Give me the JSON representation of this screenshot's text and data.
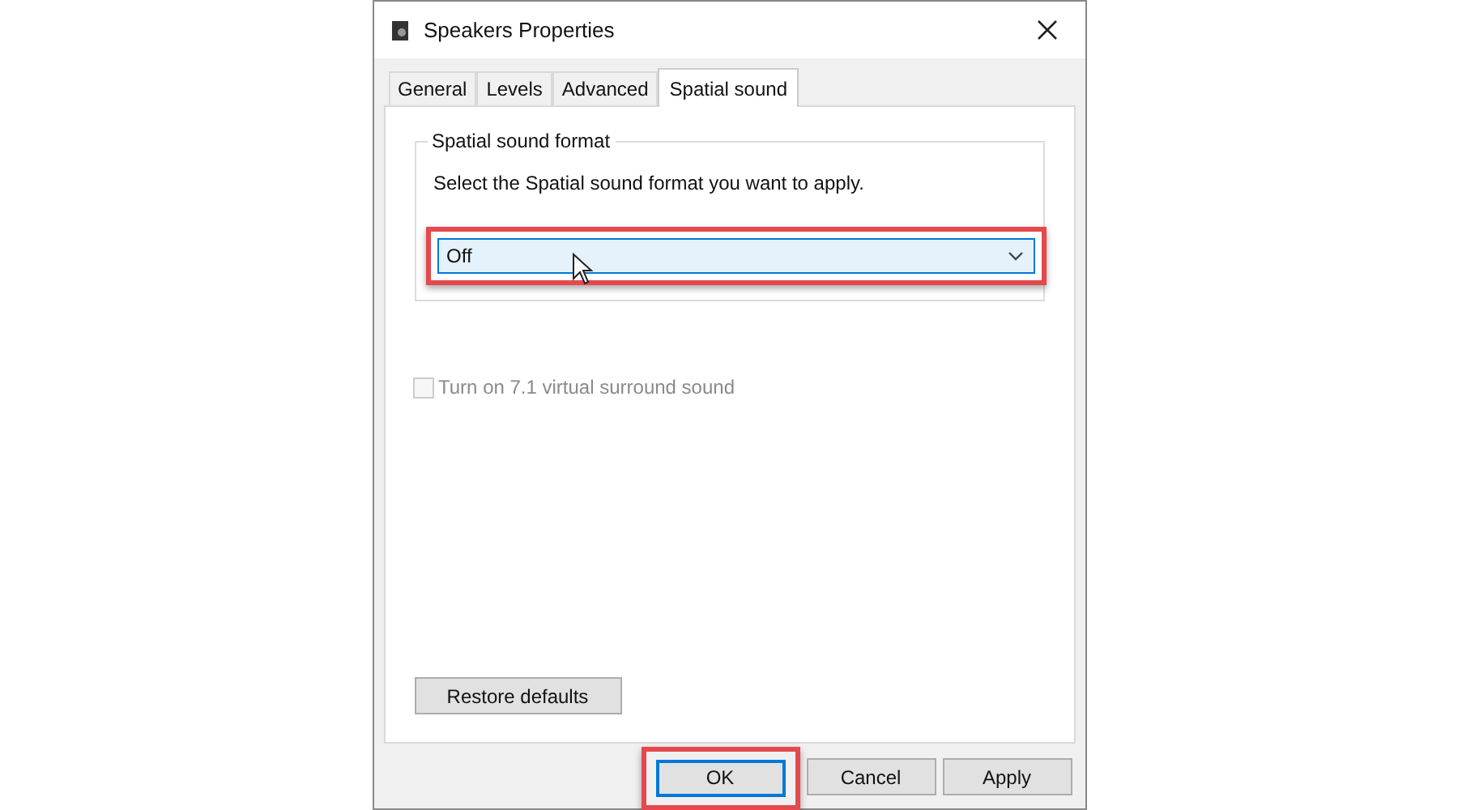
{
  "window": {
    "title": "Speakers Properties"
  },
  "tabs": [
    {
      "label": "General",
      "selected": false
    },
    {
      "label": "Levels",
      "selected": false
    },
    {
      "label": "Advanced",
      "selected": false
    },
    {
      "label": "Spatial sound",
      "selected": true
    }
  ],
  "group": {
    "legend": "Spatial sound format",
    "instruction": "Select the Spatial sound format you want to apply.",
    "dropdown": {
      "value": "Off",
      "highlighted": true
    }
  },
  "checkbox": {
    "label": "Turn on 7.1 virtual surround sound",
    "checked": false,
    "disabled": true
  },
  "restore_button": "Restore defaults",
  "buttons": [
    {
      "label": "OK",
      "highlighted": true
    },
    {
      "label": "Cancel",
      "highlighted": false
    },
    {
      "label": "Apply",
      "highlighted": false
    }
  ]
}
